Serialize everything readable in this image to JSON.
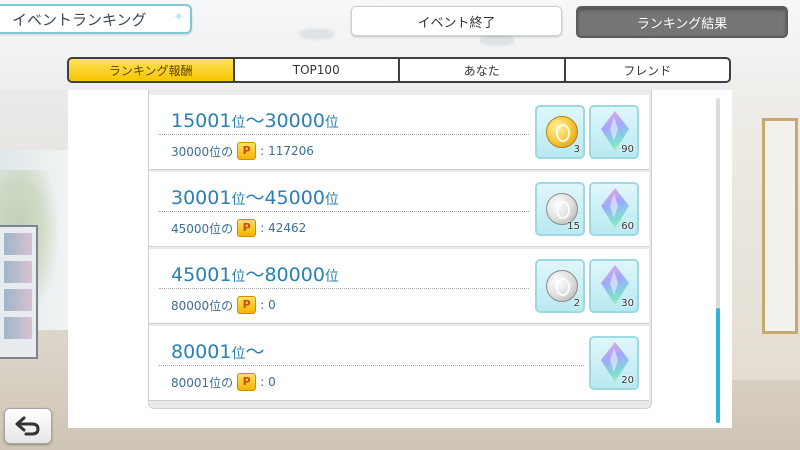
{
  "header": {
    "title": "イベントランキング",
    "event_end_label": "イベント終了",
    "ranking_result_label": "ランキング結果"
  },
  "tabs": [
    {
      "label": "ランキング報酬",
      "active": true
    },
    {
      "label": "TOP100",
      "active": false
    },
    {
      "label": "あなた",
      "active": false
    },
    {
      "label": "フレンド",
      "active": false
    }
  ],
  "rewards": [
    {
      "rank_from": "15001",
      "rank_to": "30000",
      "unit": "位",
      "range_sep": "〜",
      "border_label": "30000位の",
      "points": "117206",
      "items": [
        {
          "icon": "gold-coin-icon",
          "count": "3"
        },
        {
          "icon": "crystal-gem-icon",
          "count": "90"
        }
      ]
    },
    {
      "rank_from": "30001",
      "rank_to": "45000",
      "unit": "位",
      "range_sep": "〜",
      "border_label": "45000位の",
      "points": "42462",
      "items": [
        {
          "icon": "silver-coin-icon",
          "count": "15"
        },
        {
          "icon": "crystal-gem-icon",
          "count": "60"
        }
      ]
    },
    {
      "rank_from": "45001",
      "rank_to": "80000",
      "unit": "位",
      "range_sep": "〜",
      "border_label": "80000位の",
      "points": "0",
      "items": [
        {
          "icon": "silver-coin-icon",
          "count": "2"
        },
        {
          "icon": "crystal-gem-icon",
          "count": "30"
        }
      ]
    },
    {
      "rank_from": "80001",
      "rank_to": "",
      "unit": "位",
      "range_sep": "〜",
      "border_label": "80001位の",
      "points": "0",
      "items": [
        {
          "icon": "crystal-gem-icon",
          "count": "20"
        }
      ]
    }
  ],
  "point_badge": "P",
  "point_colon": ":",
  "colors": {
    "accent": "#7fc9d6",
    "active_tab": "#f7c600",
    "rank_text": "#2a7fb3",
    "scrollbar": "#2fb6d4"
  },
  "back_button": {
    "icon": "back-arrow-icon"
  }
}
